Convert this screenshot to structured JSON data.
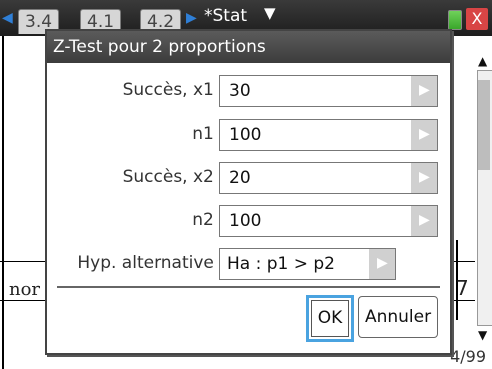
{
  "tabbar": {
    "tabs": [
      "3.4",
      "4.1",
      "4.2"
    ],
    "document_title": "*Stat",
    "caret": "▼",
    "close": "X"
  },
  "document": {
    "row_left_text": "nor",
    "row_right_text": "7",
    "page_indicator": "4/99"
  },
  "dialog": {
    "title": "Z-Test pour 2 proportions",
    "fields": [
      {
        "label": "Succès, x1 :",
        "value": "30"
      },
      {
        "label": "n1 :",
        "value": "100"
      },
      {
        "label": "Succès, x2 :",
        "value": "20"
      },
      {
        "label": "n2 :",
        "value": "100"
      }
    ],
    "alt_hypothesis": {
      "label": "Hyp. alternative :",
      "value": "Ha : p1 > p2"
    },
    "ok_label": "OK",
    "cancel_label": "Annuler"
  },
  "icons": {
    "nav_left": "◀",
    "nav_right": "▶",
    "field_arrow": "▶",
    "scroll_up": "▲",
    "scroll_down": "▼"
  },
  "colors": {
    "accent_blue": "#4aa3e0",
    "titlebar_dark": "#3c3c3c",
    "close_red": "#d84545"
  }
}
